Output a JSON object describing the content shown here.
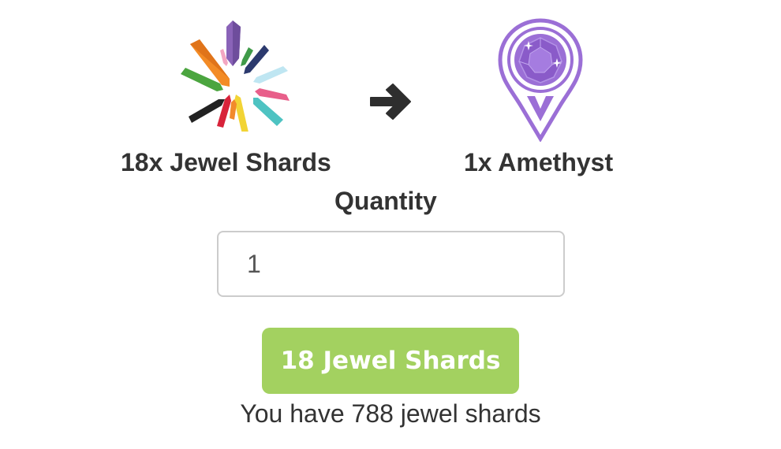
{
  "exchange": {
    "from_label": "18x Jewel Shards",
    "to_label": "1x Amethyst",
    "from_icon": "jewel-shards-icon",
    "to_icon": "amethyst-icon",
    "arrow_icon": "arrow-right-icon"
  },
  "quantity": {
    "label": "Quantity",
    "value": "1"
  },
  "buy_button": {
    "label": "18 Jewel Shards"
  },
  "balance_text": "You have 788 jewel shards",
  "colors": {
    "button": "#a3d160",
    "amethyst": "#9b6fd6",
    "text": "#333333"
  }
}
